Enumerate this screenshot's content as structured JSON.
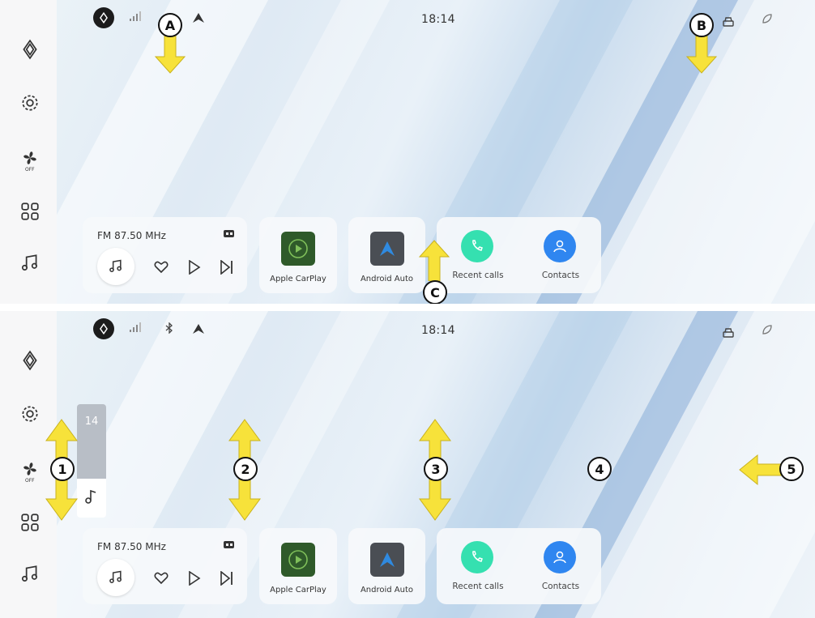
{
  "top_screen": {
    "status": {
      "time": "18:14"
    },
    "radio": {
      "station": "FM 87.50 MHz"
    },
    "apps": [
      {
        "label": "Apple CarPlay"
      },
      {
        "label": "Android Auto"
      }
    ],
    "calls": [
      {
        "label": "Recent calls"
      },
      {
        "label": "Contacts"
      }
    ],
    "callouts": [
      "A",
      "B",
      "C"
    ]
  },
  "bottom_screen": {
    "status": {
      "time": "18:14"
    },
    "volume": {
      "value": "14"
    },
    "radio": {
      "station": "FM 87.50 MHz"
    },
    "apps": [
      {
        "label": "Apple CarPlay"
      },
      {
        "label": "Android Auto"
      }
    ],
    "calls": [
      {
        "label": "Recent calls"
      },
      {
        "label": "Contacts"
      }
    ],
    "callouts": [
      "1",
      "2",
      "3",
      "4",
      "5"
    ]
  },
  "rail": {
    "fan_state": "OFF"
  },
  "icons": [
    "brand-logo-icon",
    "settings-gear-icon",
    "fan-icon",
    "apps-grid-icon",
    "music-note-icon",
    "signal-icon",
    "bluetooth-icon",
    "navigation-icon",
    "car-icon",
    "eco-icon",
    "heart-icon",
    "play-icon",
    "next-icon",
    "phone-icon",
    "contact-icon"
  ],
  "colors": {
    "carplay_tile": "#2f5a2a",
    "android_tile": "#4a4e54",
    "recent_calls": "#35e0b0",
    "contacts": "#2f86f0",
    "arrow_yellow": "#f7e23a"
  }
}
